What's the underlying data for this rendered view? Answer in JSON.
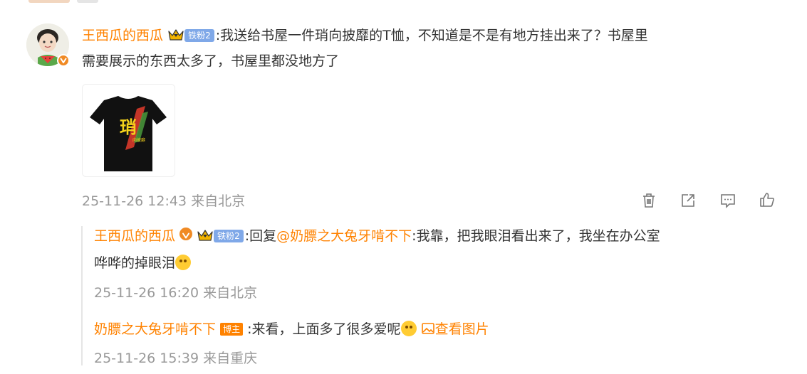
{
  "main_comment": {
    "username": "王西瓜的西瓜",
    "fan_badge": "铁粉2",
    "text_line1": ":我送给书屋一件琑向披靡的T恤，不知道是不是有地方挂出来了？书屋里",
    "text_line2": "需要展示的东西太多了，书屋里都没地方了",
    "timestamp": "25-11-26 12:43 来自北京",
    "shirt_print": "琑",
    "shirt_subtext": "向披靡"
  },
  "replies": [
    {
      "username": "王西瓜的西瓜",
      "fan_badge": "铁粉2",
      "reply_prefix": ":回复",
      "mention": "@奶膘之大兔牙啃不下",
      "text_line1_rest": ":我靠，把我眼泪看出来了，我坐在办公室",
      "text_line2": "哗哗的掉眼泪",
      "timestamp": "25-11-26 16:20 来自北京"
    },
    {
      "username": "奶膘之大兔牙啃不下",
      "role_badge": "博主",
      "text": ":来看，上面多了很多爱呢",
      "image_link": "查看图片",
      "timestamp": "25-11-26 15:39 来自重庆"
    }
  ],
  "icons": [
    "trash-icon",
    "share-icon",
    "comment-icon",
    "like-icon",
    "crown-icon",
    "verified-icon",
    "image-icon"
  ],
  "colors": {
    "accent": "#ff8200",
    "meta_text": "#999999",
    "fan_badge": "#7fa8e8",
    "verified": "#f08a24"
  }
}
